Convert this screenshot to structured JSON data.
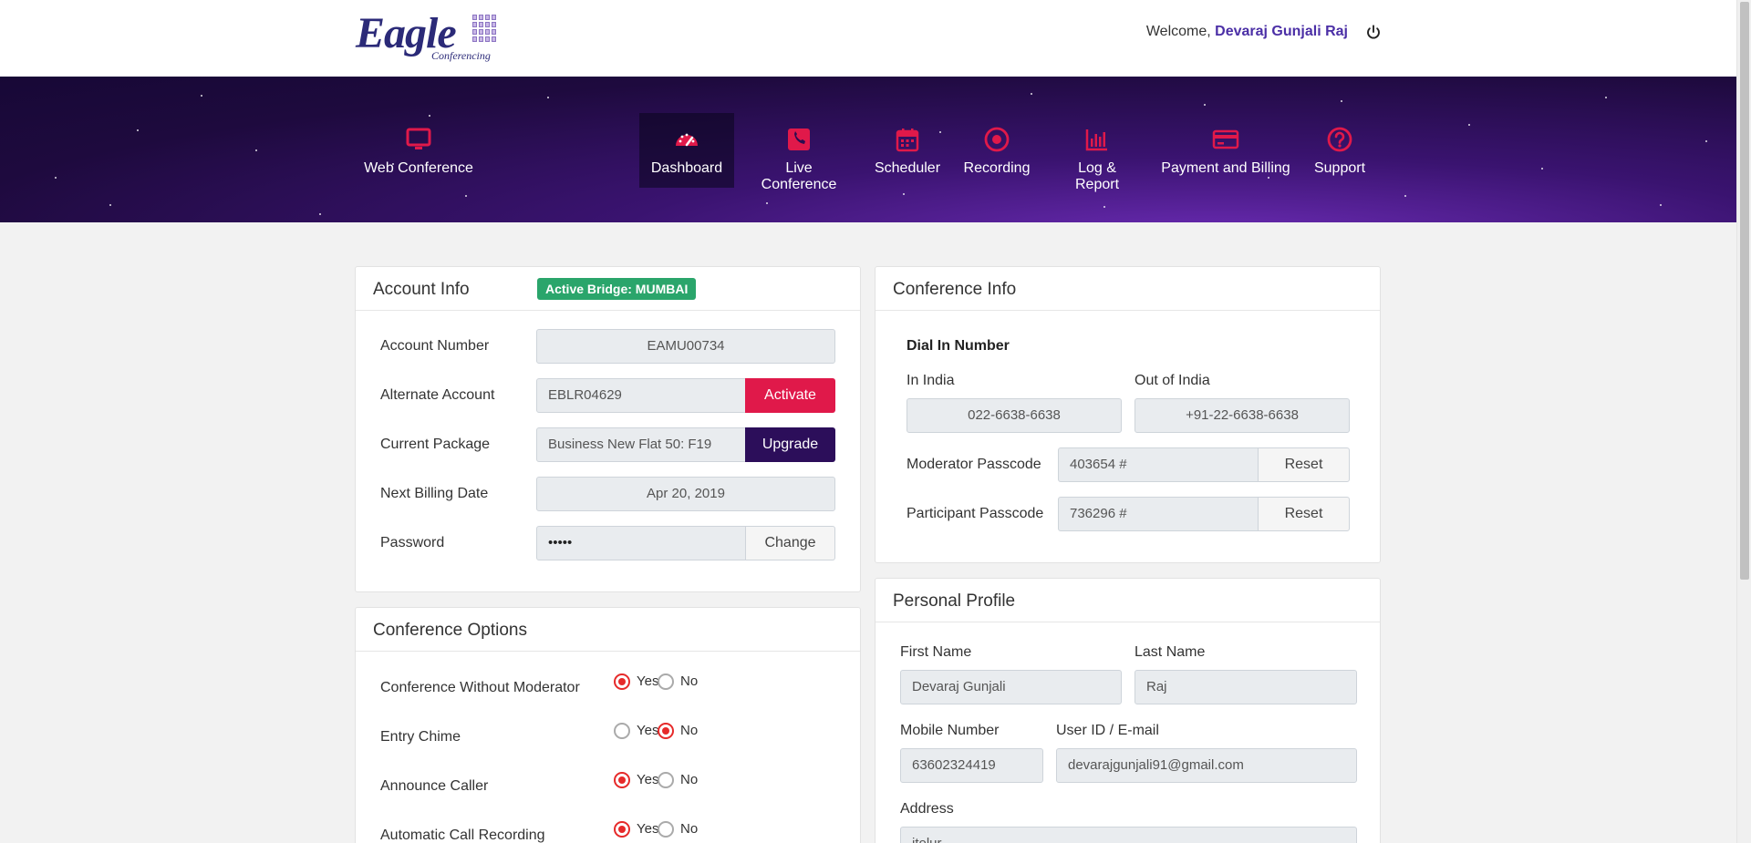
{
  "header": {
    "logo_text": "Eagle",
    "logo_subtext": "Conferencing",
    "welcome_prefix": "Welcome,",
    "user_name": "Devaraj Gunjali Raj",
    "logout_icon": "power-icon"
  },
  "nav": {
    "web_conference": "Web Conference",
    "items": [
      {
        "label": "Dashboard",
        "icon": "speedometer-icon",
        "active": true
      },
      {
        "label": "Live Conference",
        "icon": "phone-icon"
      },
      {
        "label": "Scheduler",
        "icon": "calendar-icon"
      },
      {
        "label": "Recording",
        "icon": "record-icon"
      },
      {
        "label": "Log & Report",
        "icon": "bar-chart-icon"
      },
      {
        "label": "Payment and Billing",
        "icon": "credit-card-icon"
      },
      {
        "label": "Support",
        "icon": "help-icon"
      }
    ],
    "accent_color": "#e0194a"
  },
  "account": {
    "title": "Account Info",
    "badge": "Active Bridge: MUMBAI",
    "account_number_label": "Account Number",
    "account_number": "EAMU00734",
    "alternate_label": "Alternate Account",
    "alternate_value": "EBLR04629",
    "activate": "Activate",
    "package_label": "Current Package",
    "package_value": "Business New Flat 50: F19",
    "upgrade": "Upgrade",
    "billing_label": "Next Billing Date",
    "billing_value": "Apr 20, 2019",
    "password_label": "Password",
    "password_value": "•••••",
    "change": "Change"
  },
  "options": {
    "title": "Conference Options",
    "yes": "Yes",
    "no": "No",
    "rows": [
      {
        "label": "Conference Without Moderator",
        "value": "Yes"
      },
      {
        "label": "Entry Chime",
        "value": "No"
      },
      {
        "label": "Announce Caller",
        "value": "Yes"
      },
      {
        "label": "Automatic Call Recording",
        "value": "Yes"
      }
    ]
  },
  "conference": {
    "title": "Conference Info",
    "dial_in": "Dial In Number",
    "in_india_label": "In India",
    "in_india": "022-6638-6638",
    "out_india_label": "Out of India",
    "out_india": "+91-22-6638-6638",
    "moderator_label": "Moderator Passcode",
    "moderator_value": "403654 #",
    "participant_label": "Participant Passcode",
    "participant_value": "736296 #",
    "reset": "Reset"
  },
  "profile": {
    "title": "Personal Profile",
    "first_name_label": "First Name",
    "first_name": "Devaraj Gunjali",
    "last_name_label": "Last Name",
    "last_name": "Raj",
    "mobile_label": "Mobile Number",
    "mobile": "63602324419",
    "userid_label": "User ID / E-mail",
    "userid": "devarajgunjali91@gmail.com",
    "address_label": "Address",
    "address": "itolur"
  }
}
